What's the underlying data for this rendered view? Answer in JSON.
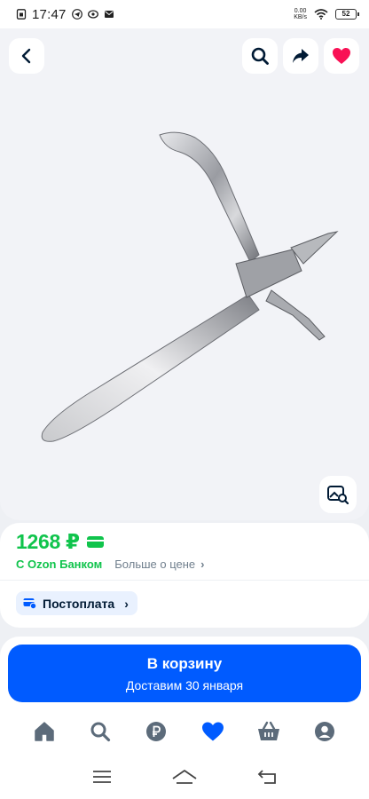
{
  "status_bar": {
    "time": "17:47",
    "net_speed_value": "0.00",
    "net_speed_unit": "KB/s",
    "battery": "52"
  },
  "product": {
    "price": "1268 ₽",
    "bank_label": "С Ozon Банком",
    "more_price_label": "Больше о цене",
    "postpay_label": "Постоплата"
  },
  "cta": {
    "title": "В корзину",
    "subtitle": "Доставим 30 января"
  },
  "colors": {
    "accent": "#005bff",
    "price_green": "#10c44c",
    "favorite_pink": "#f91155"
  },
  "icons": {
    "top_bar": [
      "back-icon",
      "search-icon",
      "share-icon",
      "heart-icon"
    ],
    "tab_bar": [
      "home-icon",
      "search-icon",
      "ruble-icon",
      "heart-icon",
      "cart-icon",
      "profile-icon"
    ],
    "system_nav": [
      "menu-icon",
      "home-icon",
      "back-icon"
    ]
  }
}
